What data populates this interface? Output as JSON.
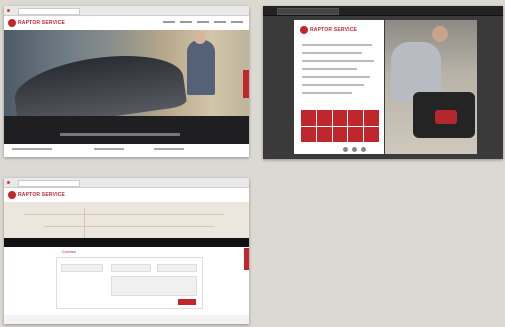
{
  "thumbnails": [
    {
      "id": "homepage",
      "logo_text": "RAPTOR SERVICE"
    },
    {
      "id": "brochure",
      "logo_text": "RAPTOR SERVICE"
    },
    {
      "id": "contact",
      "logo_text": "RAPTOR SERVICE",
      "form_label": "Contact"
    }
  ],
  "colors": {
    "brand_red": "#c0272d",
    "background": "#dcd9d2"
  }
}
